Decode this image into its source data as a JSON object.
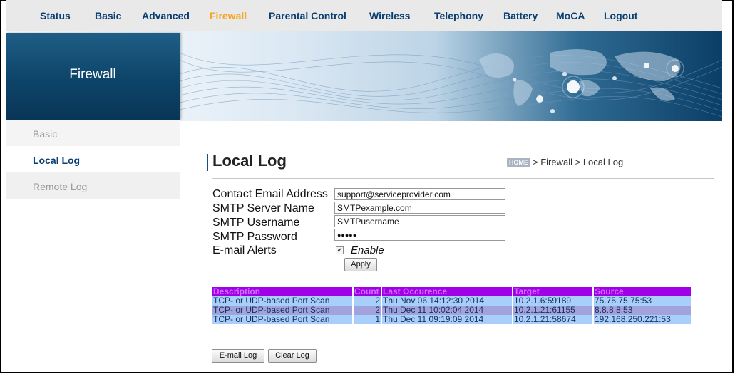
{
  "nav": {
    "items": [
      "Status",
      "Basic",
      "Advanced",
      "Firewall",
      "Parental Control",
      "Wireless",
      "Telephony",
      "Battery",
      "MoCA",
      "Logout"
    ],
    "active": "Firewall"
  },
  "banner": {
    "title": "Firewall"
  },
  "sidebar": {
    "items": [
      "Basic",
      "Local Log",
      "Remote Log"
    ],
    "active": "Local Log"
  },
  "page": {
    "title": "Local Log",
    "breadcrumb": {
      "home": "HOME",
      "trail": "> Firewall > ",
      "current": "Local Log"
    }
  },
  "form": {
    "contact_email_label": "Contact Email Address",
    "contact_email_value": "support@serviceprovider.com",
    "smtp_server_label": "SMTP Server Name",
    "smtp_server_value": "SMTPexample.com",
    "smtp_username_label": "SMTP Username",
    "smtp_username_value": "SMTPusername",
    "smtp_password_label": "SMTP Password",
    "smtp_password_value": "●●●●●",
    "email_alerts_label": "E-mail Alerts",
    "enable_label": "Enable",
    "enable_checked": true,
    "apply_label": "Apply"
  },
  "log": {
    "headers": [
      "Description",
      "Count",
      "Last Occurence",
      "Target",
      "Source"
    ],
    "rows": [
      [
        "TCP- or UDP-based Port Scan",
        "2",
        "Thu Nov 06 14:12:30 2014",
        "10.2.1.6:59189",
        "75.75.75.75:53"
      ],
      [
        "TCP- or UDP-based Port Scan",
        "2",
        "Thu Dec 11 10:02:04 2014",
        "10.2.1.21:61155",
        "8.8.8.8:53"
      ],
      [
        "TCP- or UDP-based Port Scan",
        "1",
        "Thu Dec 11 09:19:09 2014",
        "10.2.1.21:58674",
        "192.168.250.221:53"
      ]
    ]
  },
  "buttons": {
    "email_log": "E-mail Log",
    "clear_log": "Clear Log"
  },
  "colors": {
    "nav_text": "#0a3f73",
    "nav_active": "#f5a623",
    "table_header": "#a100e6",
    "row_light": "#a8cffb",
    "row_alt": "#a2a2dc"
  }
}
